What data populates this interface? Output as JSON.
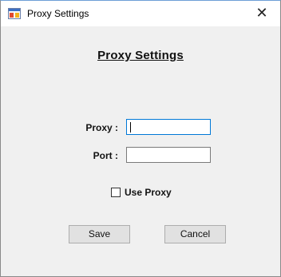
{
  "window": {
    "title": "Proxy Settings",
    "close_glyph": "✕",
    "icon": "app-window-icon"
  },
  "form": {
    "heading": "Proxy Settings",
    "proxy_label": "Proxy :",
    "proxy_value": "",
    "port_label": "Port :",
    "port_value": "",
    "use_proxy_label": "Use Proxy",
    "use_proxy_checked": false
  },
  "buttons": {
    "save_label": "Save",
    "cancel_label": "Cancel"
  }
}
